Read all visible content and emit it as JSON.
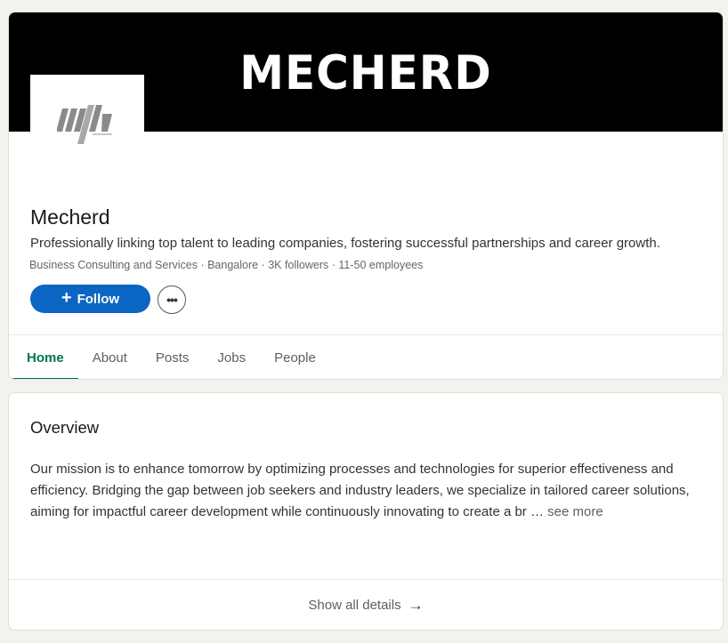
{
  "company": {
    "cover_text": "MECHERD",
    "name": "Mecherd",
    "tagline": "Professionally linking top talent to leading companies, fostering successful partnerships and career growth.",
    "meta": "Business Consulting and Services · Bangalore · 3K followers · 11-50 employees",
    "follow_label": "Follow",
    "follow_icon": "plus-icon",
    "more_icon": "ellipsis-icon",
    "more_label": "•••",
    "logo_letters": "mh"
  },
  "tabs": [
    {
      "label": "Home",
      "active": true
    },
    {
      "label": "About",
      "active": false
    },
    {
      "label": "Posts",
      "active": false
    },
    {
      "label": "Jobs",
      "active": false
    },
    {
      "label": "People",
      "active": false
    }
  ],
  "overview": {
    "title": "Overview",
    "text": "Our mission is to enhance tomorrow by optimizing processes and technologies for superior effectiveness and efficiency. Bridging the gap between job seekers and industry leaders, we specialize in tailored career solutions, aiming for impactful career development while continuously innovating to create a br … ",
    "see_more_label": "see more",
    "show_all_label": "Show all details",
    "arrow_icon": "arrow-right-icon"
  },
  "colors": {
    "accent": "#0a66c2",
    "active_tab": "#01754f",
    "page_background": "#f4f2ee"
  }
}
